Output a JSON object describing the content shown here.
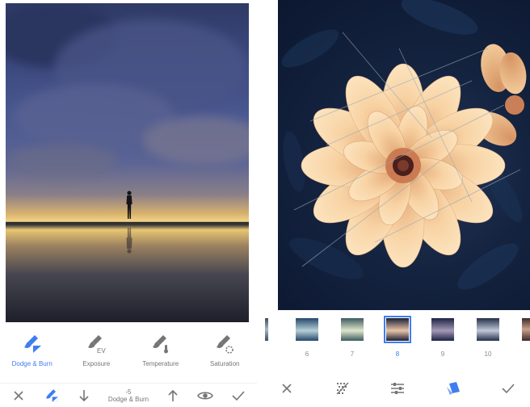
{
  "left_screen": {
    "tools": [
      {
        "label": "Dodge & Burn",
        "icon": "brush-dodge-burn-icon",
        "active": true
      },
      {
        "label": "Exposure",
        "icon": "brush-exposure-icon",
        "sub": "EV",
        "active": false
      },
      {
        "label": "Temperature",
        "icon": "brush-temperature-icon",
        "active": false
      },
      {
        "label": "Saturation",
        "icon": "brush-saturation-icon",
        "active": false
      }
    ],
    "bottom_bar": {
      "value": "-5",
      "tool_label": "Dodge & Burn"
    }
  },
  "right_screen": {
    "filters": [
      {
        "num": "6",
        "selected": false
      },
      {
        "num": "7",
        "selected": false
      },
      {
        "num": "8",
        "selected": true
      },
      {
        "num": "9",
        "selected": false
      },
      {
        "num": "10",
        "selected": false
      }
    ]
  },
  "colors": {
    "accent": "#3d7ef0",
    "icon_gray": "#757575"
  }
}
